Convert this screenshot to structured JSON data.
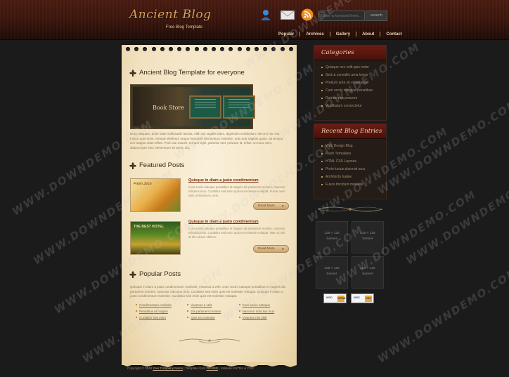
{
  "header": {
    "logo": "Ancient Blog",
    "tagline": "Free Blog Template",
    "search_placeholder": "Enter a keyword here...",
    "search_button": "search",
    "nav": [
      "Popular",
      "Archives",
      "Gallery",
      "About",
      "Contact"
    ]
  },
  "main": {
    "intro_title": "Ancient Blog Template for everyone",
    "banner_text": "Book Store",
    "intro_text": "Nunc aliquam, dolor vitae sollicitudin lacinia, nibh dui sagittis diam, dignissim vestibulum nisl orci nec est. Fusce quis enim. Aenean eleifend, neque hendrerit elementum molestie, odio erat sagittis quam, sit tempor orci magna vitae tellus. Proin dui mauris, tempor eget, pulvinar sed, pulvinar id, tellus. Ut nunc sem, ullamcorper sed, elementum sit amet, dui.",
    "featured_title": "Featured Posts",
    "featured": [
      {
        "title": "Quisque in diam a justo condimentum",
        "thumb": "Fresh Juice",
        "text": "Cum sociis natoque penatibus et magnis dis parturient montes, nascetur ridiculus mus. Curabitur sed enim quis est molestie volutpat. Fusce nunc velit, vehicula eu, sem."
      },
      {
        "title": "Quisque in diam a justo condimentum",
        "thumb": "THE BEST HOTEL",
        "text": "Cum sociis natoque penatibus et magnis dis parturient montes, nascetur ridiculus mus. Curabitur sed enim quis est molestie volutpat. Nam ut nisi at elit cursus ultrices."
      }
    ],
    "read_more": "Read More",
    "popular_title": "Popular Posts",
    "popular_text": "Quisque in diam a justo condimentum molestie. Vivamus a velit. Cum sociis natoque penatibus et magnis dis parturient montes, nascetur ridiculus mus. Curabitur sed enim quis est molestie volutpat. Quisque in diam a justo condimentum molestie. Curabitur sed enim quis est molestie volutpat.",
    "popular_links": [
      "Condimentum molestie",
      "Vivamus a velit",
      "Cum sociis natoque",
      "Penatibus et magnis",
      "Dis parturient montes",
      "Nascetur ridiculus mus",
      "Curabitur sed enim",
      "Quis est molestie",
      "Vivamus nisi nibh"
    ]
  },
  "sidebar": {
    "categories_title": "Categories",
    "categories": [
      "Quisque nec velit quis tortor",
      "Sed ut convallis urna lorem",
      "Pretium ante sit voluptatum",
      "Cum sociis natoque penatibus",
      "Rutrum nec posuere",
      "Vestibulum consectetur"
    ],
    "recent_title": "Recent Blog Entries",
    "recent": [
      "Web Design Blog",
      "Flash Templates",
      "HTML CSS Layouts",
      "Proin luctus placerat arcu",
      "Architectu tualae",
      "Fusce tincidunt molestie"
    ],
    "ads": [
      {
        "size": "125 × 125",
        "label": "banner"
      },
      {
        "size": "125 × 125",
        "label": "banner"
      },
      {
        "size": "125 × 125",
        "label": "banner"
      },
      {
        "size": "125 × 125",
        "label": "banner"
      }
    ],
    "badges": [
      {
        "name": "W3C",
        "version": "XHTML 1.0"
      },
      {
        "name": "W3C",
        "version": "CSS"
      }
    ]
  },
  "footer": {
    "copyright": "Copyright © 2048",
    "site_link": "Your Company Name",
    "template_from": "| Template from",
    "template_link": "FRUISE",
    "valid": "| Validate XHTML & CSS"
  },
  "watermark": "WWW.DOWNDEMO.COM",
  "colors": {
    "header": "#3a150c",
    "accent": "#7a2a10",
    "paper": "#f2e1bf",
    "sidebar_head": "#6b1c14"
  }
}
